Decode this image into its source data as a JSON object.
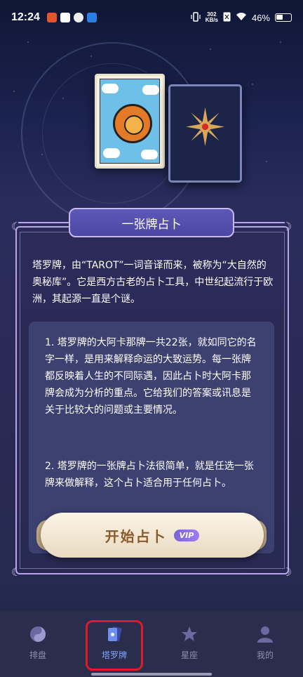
{
  "status_bar": {
    "time": "12:24",
    "net_speed_value": "302",
    "net_speed_unit": "KB/s",
    "battery": "46%"
  },
  "header": {
    "title": "一张牌占卜"
  },
  "intro": {
    "text": "塔罗牌，由“TAROT”一词音译而来，被称为“大自然的奥秘库”。它是西方古老的占卜工具，中世纪起流行于欧洲，其起源一直是个谜。"
  },
  "details": {
    "para1": "1. 塔罗牌的大阿卡那牌一共22张，就如同它的名字一样，是用来解释命运的大致运势。每一张牌都反映着人生的不同际遇，因此占卜时大阿卡那牌会成为分析的重点。它给我们的答案或讯息是关于比较大的问题或主要情况。",
    "para2": "2. 塔罗牌的一张牌占卜法很简单，就是任选一张牌来做解释，这个占卜适合用于任何占卜。"
  },
  "start_button": {
    "label": "开始占卜",
    "badge": "VIP"
  },
  "bottom_nav": {
    "items": [
      {
        "label": "排盘",
        "icon": "chart-wheel-icon",
        "active": false
      },
      {
        "label": "塔罗牌",
        "icon": "tarot-card-icon",
        "active": true
      },
      {
        "label": "星座",
        "icon": "star-icon",
        "active": false
      },
      {
        "label": "我的",
        "icon": "user-icon",
        "active": false
      }
    ]
  },
  "colors": {
    "accent": "#7fa4ff",
    "ribbon": "#5e57b8",
    "button_text": "#8a5a2b",
    "highlight": "#e11a2a"
  }
}
